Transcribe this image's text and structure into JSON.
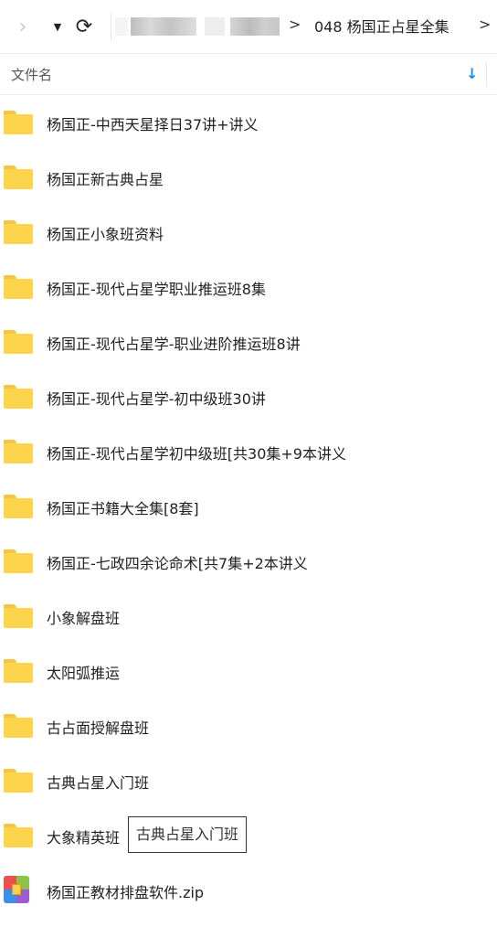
{
  "toolbar": {
    "back_icon": "chevron-right-icon",
    "dropdown_icon": "caret-down-icon",
    "refresh_icon": "refresh-icon",
    "breadcrumb_separator": ">",
    "current_folder": "048 杨国正占星全集",
    "trailing_separator": ">"
  },
  "header": {
    "name_column": "文件名",
    "sort_icon": "sort-down-arrow-icon",
    "sort_color": "#1e87f0"
  },
  "files": [
    {
      "name": "杨国正-中西天星择日37讲+讲义",
      "type": "folder"
    },
    {
      "name": "杨国正新古典占星",
      "type": "folder"
    },
    {
      "name": "杨国正小象班资料",
      "type": "folder"
    },
    {
      "name": "杨国正-现代占星学职业推运班8集",
      "type": "folder"
    },
    {
      "name": "杨国正-现代占星学-职业进阶推运班8讲",
      "type": "folder"
    },
    {
      "name": "杨国正-现代占星学-初中级班30讲",
      "type": "folder"
    },
    {
      "name": "杨国正-现代占星学初中级班[共30集+9本讲义",
      "type": "folder"
    },
    {
      "name": "杨国正书籍大全集[8套]",
      "type": "folder"
    },
    {
      "name": "杨国正-七政四余论命术[共7集+2本讲义",
      "type": "folder"
    },
    {
      "name": "小象解盘班",
      "type": "folder"
    },
    {
      "name": "太阳弧推运",
      "type": "folder"
    },
    {
      "name": "古占面授解盘班",
      "type": "folder"
    },
    {
      "name": "古典占星入门班",
      "type": "folder"
    },
    {
      "name": "大象精英班",
      "type": "folder"
    },
    {
      "name": "杨国正教材排盘软件.zip",
      "type": "zip"
    }
  ],
  "tooltip": {
    "text": "古典占星入门班"
  },
  "colors": {
    "folder": "#fcd54c",
    "accent": "#1e87f0"
  }
}
